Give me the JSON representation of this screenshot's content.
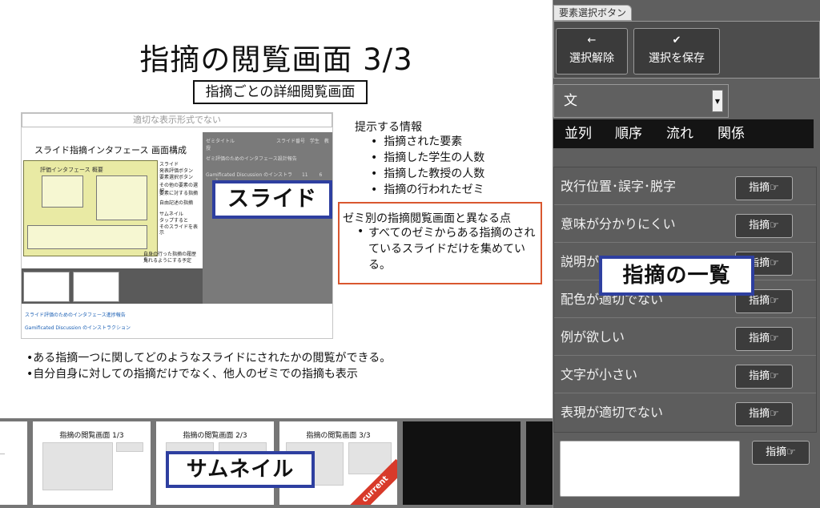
{
  "slide": {
    "title": "指摘の閲覧画面 3/3",
    "subtitle": "指摘ごとの詳細閲覧画面",
    "embedded": {
      "warning": "適切な表示形式でない",
      "inner_title": "スライド指摘インタフェース 画面構成",
      "inner_diagram_label": "評価インタフェース 概要",
      "side_labels": [
        "スライド",
        "発表評価ボタン",
        "要素選択ボタン",
        "その他の要素の選択",
        "要素に対する指摘",
        "自由記述の指摘",
        "サムネイル",
        "タップすると",
        "そのスライドを表示",
        "自身の行った指摘の履歴も",
        "見れるようにする予定"
      ],
      "table_header": [
        "ゼミタイトル",
        "スライド番号",
        "学生",
        "教授"
      ],
      "table_rows": [
        [
          "ゼミ評価のためのインタフェース設計報告",
          "",
          "",
          ""
        ],
        [
          "Gamificated Discussion のインストラ",
          "11",
          "6",
          "1"
        ]
      ],
      "links": [
        "スライド評価のためのインタフェース進捗報告",
        "Gamificated Discussion のインストラクション"
      ]
    },
    "info_heading": "提示する情報",
    "info_items": [
      "指摘された要素",
      "指摘した学生の人数",
      "指摘した教授の人数",
      "指摘の行われたゼミ"
    ],
    "diff_heading": "ゼミ別の指摘閲覧画面と異なる点",
    "diff_bullet": "•",
    "diff_text": "すべてのゼミからある指摘のされているスライドだけを集めている。",
    "notes": [
      "•ある指摘一つに関してどのようなスライドにされたかの閲覧ができる。",
      "•自分自身に対しての指摘だけでなく、他人のゼミでの指摘も表示"
    ]
  },
  "tags": {
    "slide": "スライド",
    "thumbnail": "サムネイル",
    "comment_list": "指摘の一覧"
  },
  "thumbnails": [
    {
      "title": "",
      "dark": false
    },
    {
      "title": "指摘の閲覧画面 1/3",
      "dark": false
    },
    {
      "title": "指摘の閲覧画面 2/3",
      "dark": false
    },
    {
      "title": "指摘の閲覧画面 3/3",
      "dark": false,
      "current": true
    },
    {
      "title": "",
      "dark": true
    },
    {
      "title": "",
      "dark": true
    }
  ],
  "current_label": "current",
  "panel": {
    "tab_label": "要素選択ボタン",
    "deselect_label": "選択解除",
    "save_label": "選択を保存",
    "element_select_value": "文",
    "categories": [
      "並列",
      "順序",
      "流れ",
      "関係"
    ],
    "comments": [
      "改行位置･誤字･脱字",
      "意味が分かりにくい",
      "説明が不足している",
      "配色が適切でない",
      "例が欲しい",
      "文字が小さい",
      "表現が適切でない"
    ],
    "comment_button_label": "指摘",
    "free_submit_label": "指摘",
    "free_input_value": ""
  },
  "colors": {
    "tag_border": "#2e3fa0",
    "diff_border": "#d9572f",
    "panel_bg": "#5f5f5f",
    "current_ribbon": "#d83a2a"
  },
  "icons": {
    "deselect": "arrow-left-icon",
    "save": "check-icon",
    "comment": "pointing-hand-icon",
    "select": "chevron-down-icon"
  }
}
